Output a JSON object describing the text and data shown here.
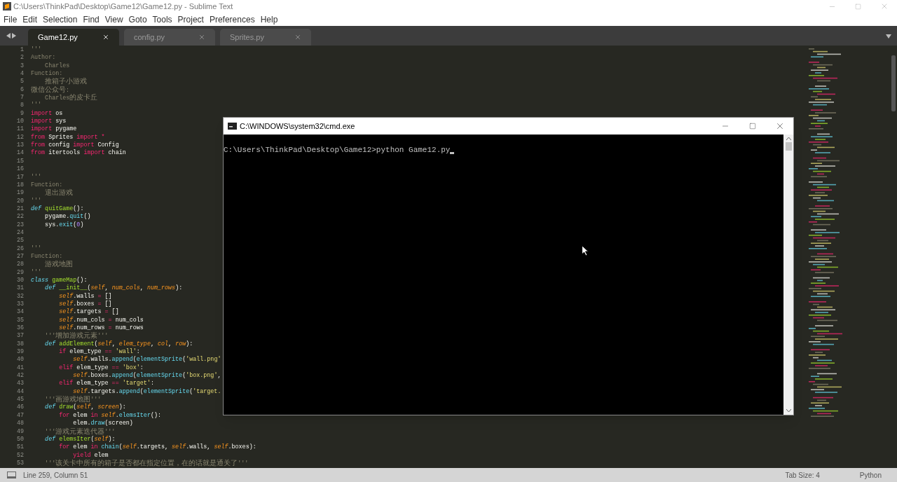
{
  "window": {
    "title": "C:\\Users\\ThinkPad\\Desktop\\Game12\\Game12.py - Sublime Text"
  },
  "menu": [
    "File",
    "Edit",
    "Selection",
    "Find",
    "View",
    "Goto",
    "Tools",
    "Project",
    "Preferences",
    "Help"
  ],
  "tabs": [
    {
      "label": "Game12.py",
      "selected": true
    },
    {
      "label": "config.py",
      "selected": false
    },
    {
      "label": "Sprites.py",
      "selected": false
    }
  ],
  "editor": {
    "lines": [
      {
        "number": "1",
        "tokens": [
          {
            "kind": "comment",
            "text": "'''"
          }
        ]
      },
      {
        "number": "2",
        "tokens": [
          {
            "kind": "comment",
            "text": "Author:"
          }
        ]
      },
      {
        "number": "3",
        "tokens": [
          {
            "kind": "comment",
            "text": "    Charles"
          }
        ]
      },
      {
        "number": "4",
        "tokens": [
          {
            "kind": "comment",
            "text": "Function:"
          }
        ]
      },
      {
        "number": "5",
        "tokens": [
          {
            "kind": "comment",
            "text": "    推箱子小游戏"
          }
        ]
      },
      {
        "number": "6",
        "tokens": [
          {
            "kind": "comment",
            "text": "微信公众号:"
          }
        ]
      },
      {
        "number": "7",
        "tokens": [
          {
            "kind": "comment",
            "text": "    Charles的皮卡丘"
          }
        ]
      },
      {
        "number": "8",
        "tokens": [
          {
            "kind": "comment",
            "text": "'''"
          }
        ]
      },
      {
        "number": "9",
        "tokens": [
          {
            "kind": "keyword",
            "text": "import"
          },
          {
            "kind": "plain",
            "text": " os"
          }
        ]
      },
      {
        "number": "10",
        "tokens": [
          {
            "kind": "keyword",
            "text": "import"
          },
          {
            "kind": "plain",
            "text": " sys"
          }
        ]
      },
      {
        "number": "11",
        "tokens": [
          {
            "kind": "keyword",
            "text": "import"
          },
          {
            "kind": "plain",
            "text": " pygame"
          }
        ]
      },
      {
        "number": "12",
        "tokens": [
          {
            "kind": "keyword",
            "text": "from"
          },
          {
            "kind": "plain",
            "text": " Sprites "
          },
          {
            "kind": "keyword",
            "text": "import"
          },
          {
            "kind": "operator",
            "text": " *"
          }
        ]
      },
      {
        "number": "13",
        "tokens": [
          {
            "kind": "keyword",
            "text": "from"
          },
          {
            "kind": "plain",
            "text": " config "
          },
          {
            "kind": "keyword",
            "text": "import"
          },
          {
            "kind": "plain",
            "text": " Config"
          }
        ]
      },
      {
        "number": "14",
        "tokens": [
          {
            "kind": "keyword",
            "text": "from"
          },
          {
            "kind": "plain",
            "text": " itertools "
          },
          {
            "kind": "keyword",
            "text": "import"
          },
          {
            "kind": "plain",
            "text": " chain"
          }
        ]
      },
      {
        "number": "15"
      },
      {
        "number": "16"
      },
      {
        "number": "17",
        "tokens": [
          {
            "kind": "comment",
            "text": "'''"
          }
        ]
      },
      {
        "number": "18",
        "tokens": [
          {
            "kind": "comment",
            "text": "Function:"
          }
        ]
      },
      {
        "number": "19",
        "tokens": [
          {
            "kind": "comment",
            "text": "    退出游戏"
          }
        ]
      },
      {
        "number": "20",
        "tokens": [
          {
            "kind": "comment",
            "text": "'''"
          }
        ]
      },
      {
        "number": "21",
        "tokens": [
          {
            "kind": "storage",
            "text": "def "
          },
          {
            "kind": "name",
            "text": "quitGame"
          },
          {
            "kind": "plain",
            "text": "():"
          }
        ]
      },
      {
        "number": "22",
        "tokens": [
          {
            "kind": "plain",
            "text": "    pygame."
          },
          {
            "kind": "call",
            "text": "quit"
          },
          {
            "kind": "plain",
            "text": "()"
          }
        ]
      },
      {
        "number": "23",
        "tokens": [
          {
            "kind": "plain",
            "text": "    sys."
          },
          {
            "kind": "call",
            "text": "exit"
          },
          {
            "kind": "plain",
            "text": "("
          },
          {
            "kind": "number",
            "text": "0"
          },
          {
            "kind": "plain",
            "text": ")"
          }
        ]
      },
      {
        "number": "24"
      },
      {
        "number": "25"
      },
      {
        "number": "26",
        "tokens": [
          {
            "kind": "comment",
            "text": "'''"
          }
        ]
      },
      {
        "number": "27",
        "tokens": [
          {
            "kind": "comment",
            "text": "Function:"
          }
        ]
      },
      {
        "number": "28",
        "tokens": [
          {
            "kind": "comment",
            "text": "    游戏地图"
          }
        ]
      },
      {
        "number": "29",
        "tokens": [
          {
            "kind": "comment",
            "text": "'''"
          }
        ]
      },
      {
        "number": "30",
        "tokens": [
          {
            "kind": "storage",
            "text": "class "
          },
          {
            "kind": "name",
            "text": "gameMap"
          },
          {
            "kind": "plain",
            "text": "():"
          }
        ]
      },
      {
        "number": "31",
        "tokens": [
          {
            "kind": "storage",
            "text": "    def "
          },
          {
            "kind": "name",
            "text": "__init__"
          },
          {
            "kind": "plain",
            "text": "("
          },
          {
            "kind": "param",
            "text": "self"
          },
          {
            "kind": "plain",
            "text": ", "
          },
          {
            "kind": "param",
            "text": "num_cols"
          },
          {
            "kind": "plain",
            "text": ", "
          },
          {
            "kind": "param",
            "text": "num_rows"
          },
          {
            "kind": "plain",
            "text": "):"
          }
        ]
      },
      {
        "number": "32",
        "tokens": [
          {
            "kind": "self",
            "text": "        self"
          },
          {
            "kind": "plain",
            "text": ".walls "
          },
          {
            "kind": "operator",
            "text": "="
          },
          {
            "kind": "plain",
            "text": " []"
          }
        ]
      },
      {
        "number": "33",
        "tokens": [
          {
            "kind": "self",
            "text": "        self"
          },
          {
            "kind": "plain",
            "text": ".boxes "
          },
          {
            "kind": "operator",
            "text": "="
          },
          {
            "kind": "plain",
            "text": " []"
          }
        ]
      },
      {
        "number": "34",
        "tokens": [
          {
            "kind": "self",
            "text": "        self"
          },
          {
            "kind": "plain",
            "text": ".targets "
          },
          {
            "kind": "operator",
            "text": "="
          },
          {
            "kind": "plain",
            "text": " []"
          }
        ]
      },
      {
        "number": "35",
        "tokens": [
          {
            "kind": "self",
            "text": "        self"
          },
          {
            "kind": "plain",
            "text": ".num_cols "
          },
          {
            "kind": "operator",
            "text": "="
          },
          {
            "kind": "plain",
            "text": " num_cols"
          }
        ]
      },
      {
        "number": "36",
        "tokens": [
          {
            "kind": "self",
            "text": "        self"
          },
          {
            "kind": "plain",
            "text": ".num_rows "
          },
          {
            "kind": "operator",
            "text": "="
          },
          {
            "kind": "plain",
            "text": " num_rows"
          }
        ]
      },
      {
        "number": "37",
        "tokens": [
          {
            "kind": "comment",
            "text": "    '''增加游戏元素'''"
          }
        ]
      },
      {
        "number": "38",
        "tokens": [
          {
            "kind": "storage",
            "text": "    def "
          },
          {
            "kind": "name",
            "text": "addElement"
          },
          {
            "kind": "plain",
            "text": "("
          },
          {
            "kind": "param",
            "text": "self"
          },
          {
            "kind": "plain",
            "text": ", "
          },
          {
            "kind": "param",
            "text": "elem_type"
          },
          {
            "kind": "plain",
            "text": ", "
          },
          {
            "kind": "param",
            "text": "col"
          },
          {
            "kind": "plain",
            "text": ", "
          },
          {
            "kind": "param",
            "text": "row"
          },
          {
            "kind": "plain",
            "text": "):"
          }
        ]
      },
      {
        "number": "39",
        "tokens": [
          {
            "kind": "keyword",
            "text": "        if"
          },
          {
            "kind": "plain",
            "text": " elem_type "
          },
          {
            "kind": "operator",
            "text": "=="
          },
          {
            "kind": "string",
            "text": " 'wall'"
          },
          {
            "kind": "plain",
            "text": ":"
          }
        ]
      },
      {
        "number": "40",
        "tokens": [
          {
            "kind": "self",
            "text": "            self"
          },
          {
            "kind": "plain",
            "text": ".walls."
          },
          {
            "kind": "call",
            "text": "append"
          },
          {
            "kind": "plain",
            "text": "("
          },
          {
            "kind": "call",
            "text": "elementSprite"
          },
          {
            "kind": "plain",
            "text": "("
          },
          {
            "kind": "string",
            "text": "'wall.png'"
          }
        ]
      },
      {
        "number": "41",
        "tokens": [
          {
            "kind": "keyword",
            "text": "        elif"
          },
          {
            "kind": "plain",
            "text": " elem_type "
          },
          {
            "kind": "operator",
            "text": "=="
          },
          {
            "kind": "string",
            "text": " 'box'"
          },
          {
            "kind": "plain",
            "text": ":"
          }
        ]
      },
      {
        "number": "42",
        "tokens": [
          {
            "kind": "self",
            "text": "            self"
          },
          {
            "kind": "plain",
            "text": ".boxes."
          },
          {
            "kind": "call",
            "text": "append"
          },
          {
            "kind": "plain",
            "text": "("
          },
          {
            "kind": "call",
            "text": "elementSprite"
          },
          {
            "kind": "plain",
            "text": "("
          },
          {
            "kind": "string",
            "text": "'box.png'"
          },
          {
            "kind": "plain",
            "text": ","
          }
        ]
      },
      {
        "number": "43",
        "tokens": [
          {
            "kind": "keyword",
            "text": "        elif"
          },
          {
            "kind": "plain",
            "text": " elem_type "
          },
          {
            "kind": "operator",
            "text": "=="
          },
          {
            "kind": "string",
            "text": " 'target'"
          },
          {
            "kind": "plain",
            "text": ":"
          }
        ]
      },
      {
        "number": "44",
        "tokens": [
          {
            "kind": "self",
            "text": "            self"
          },
          {
            "kind": "plain",
            "text": ".targets."
          },
          {
            "kind": "call",
            "text": "append"
          },
          {
            "kind": "plain",
            "text": "("
          },
          {
            "kind": "call",
            "text": "elementSprite"
          },
          {
            "kind": "plain",
            "text": "("
          },
          {
            "kind": "string",
            "text": "'target."
          }
        ]
      },
      {
        "number": "45",
        "tokens": [
          {
            "kind": "comment",
            "text": "    '''画游戏地图'''"
          }
        ]
      },
      {
        "number": "46",
        "tokens": [
          {
            "kind": "storage",
            "text": "    def "
          },
          {
            "kind": "name",
            "text": "draw"
          },
          {
            "kind": "plain",
            "text": "("
          },
          {
            "kind": "param",
            "text": "self"
          },
          {
            "kind": "plain",
            "text": ", "
          },
          {
            "kind": "param",
            "text": "screen"
          },
          {
            "kind": "plain",
            "text": "):"
          }
        ]
      },
      {
        "number": "47",
        "tokens": [
          {
            "kind": "keyword",
            "text": "        for"
          },
          {
            "kind": "plain",
            "text": " elem "
          },
          {
            "kind": "keyword",
            "text": "in"
          },
          {
            "kind": "self",
            "text": " self"
          },
          {
            "kind": "plain",
            "text": "."
          },
          {
            "kind": "call",
            "text": "elemsIter"
          },
          {
            "kind": "plain",
            "text": "():"
          }
        ]
      },
      {
        "number": "48",
        "tokens": [
          {
            "kind": "plain",
            "text": "            elem."
          },
          {
            "kind": "call",
            "text": "draw"
          },
          {
            "kind": "plain",
            "text": "(screen)"
          }
        ]
      },
      {
        "number": "49",
        "tokens": [
          {
            "kind": "comment",
            "text": "    '''游戏元素迭代器'''"
          }
        ]
      },
      {
        "number": "50",
        "tokens": [
          {
            "kind": "storage",
            "text": "    def "
          },
          {
            "kind": "name",
            "text": "elemsIter"
          },
          {
            "kind": "plain",
            "text": "("
          },
          {
            "kind": "param",
            "text": "self"
          },
          {
            "kind": "plain",
            "text": "):"
          }
        ]
      },
      {
        "number": "51",
        "tokens": [
          {
            "kind": "keyword",
            "text": "        for"
          },
          {
            "kind": "plain",
            "text": " elem "
          },
          {
            "kind": "keyword",
            "text": "in"
          },
          {
            "kind": "call",
            "text": " chain"
          },
          {
            "kind": "plain",
            "text": "("
          },
          {
            "kind": "self",
            "text": "self"
          },
          {
            "kind": "plain",
            "text": ".targets, "
          },
          {
            "kind": "self",
            "text": "self"
          },
          {
            "kind": "plain",
            "text": ".walls, "
          },
          {
            "kind": "self",
            "text": "self"
          },
          {
            "kind": "plain",
            "text": ".boxes):"
          }
        ]
      },
      {
        "number": "52",
        "tokens": [
          {
            "kind": "keyword",
            "text": "            yield"
          },
          {
            "kind": "plain",
            "text": " elem"
          }
        ]
      },
      {
        "number": "53",
        "tokens": [
          {
            "kind": "comment",
            "text": "    '''该关卡中所有的箱子是否都在指定位置，在的话就是通关了'''"
          }
        ]
      }
    ]
  },
  "console": {
    "title": "C:\\WINDOWS\\system32\\cmd.exe",
    "lines": [
      "C:\\Users\\ThinkPad\\Desktop\\Game12>python Game12.py"
    ]
  },
  "status_bar": {
    "position": "Line 259, Column 51",
    "tab_size": "Tab Size: 4",
    "syntax": "Python"
  }
}
